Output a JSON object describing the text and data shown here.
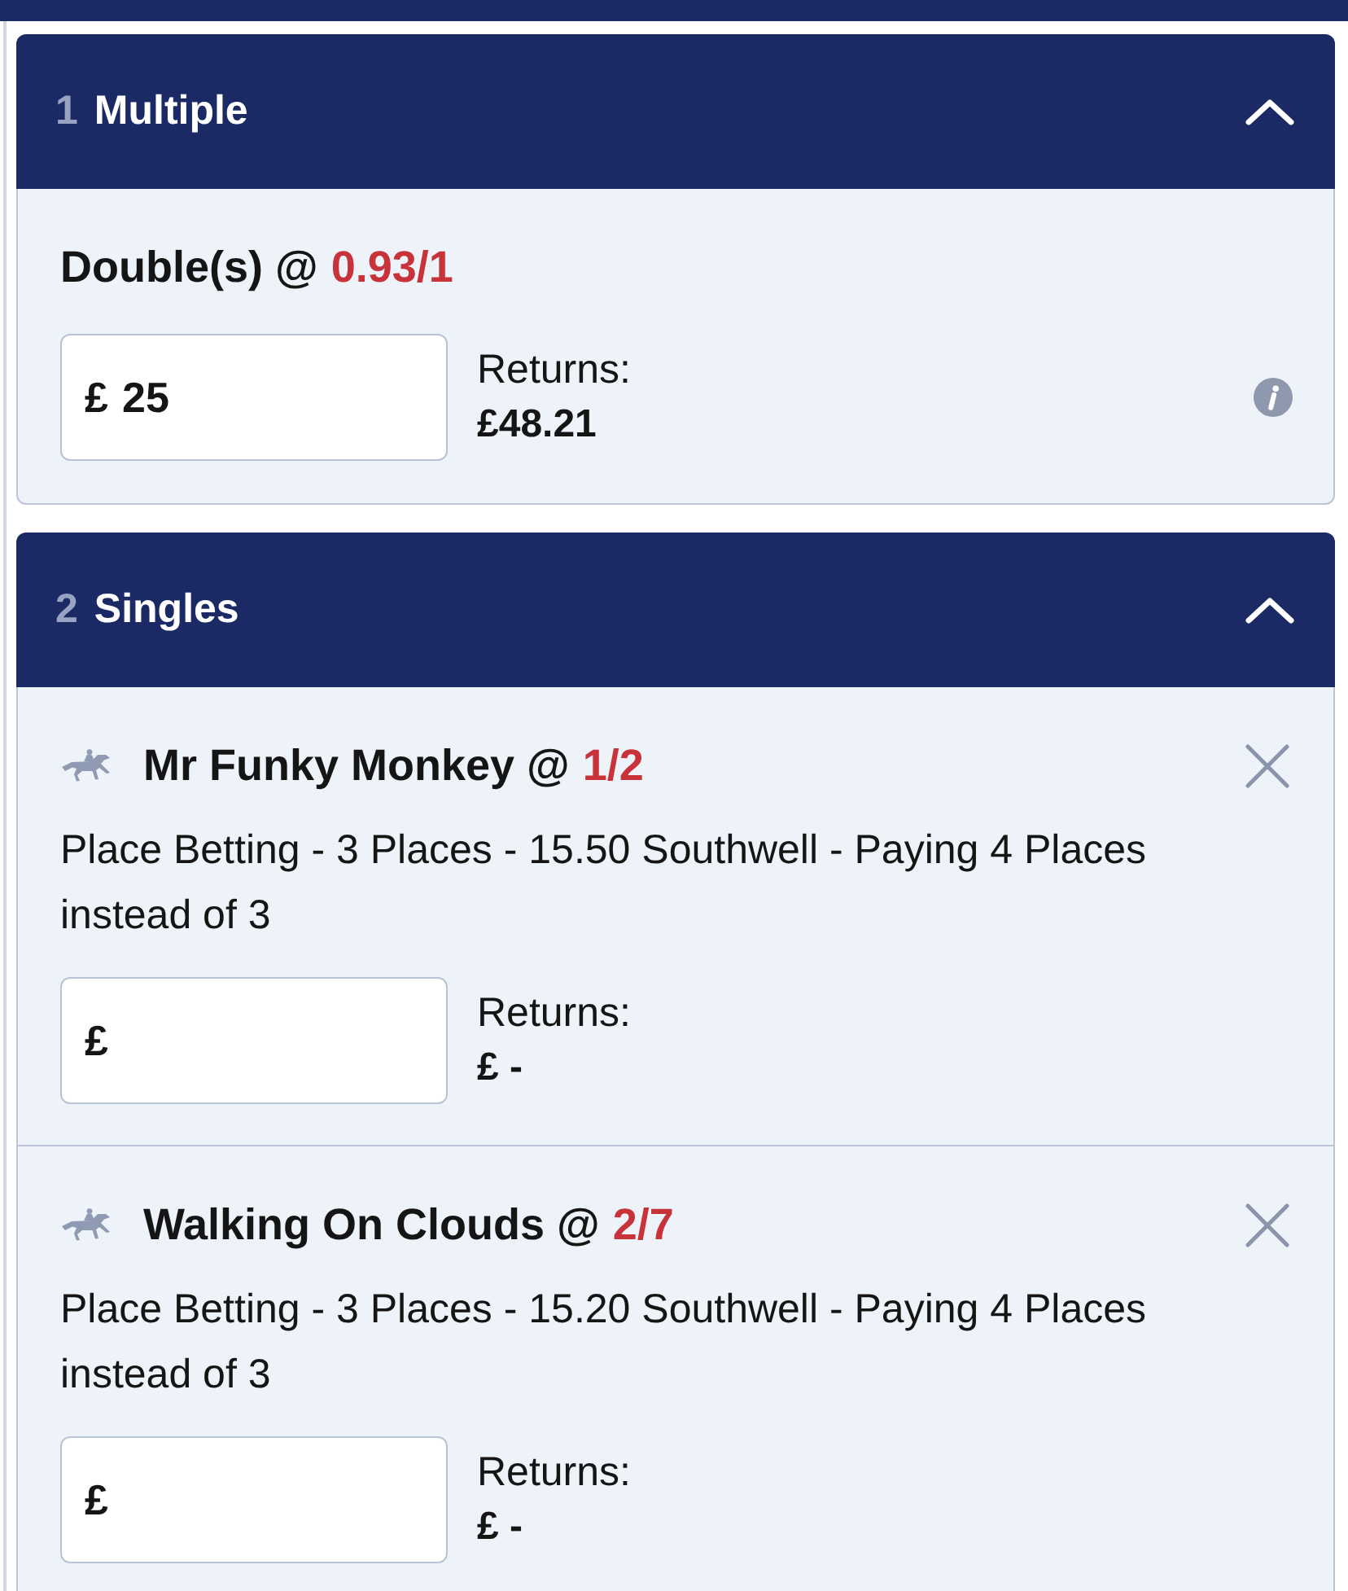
{
  "sections": [
    {
      "kind": "multiple",
      "count": "1",
      "title": "Multiple",
      "expanded": true,
      "bets": [
        {
          "title": "Double(s) @",
          "odds": "0.93/1",
          "currency": "£",
          "stake": "25",
          "returns_label": "Returns:",
          "returns": "£48.21"
        }
      ]
    },
    {
      "kind": "singles",
      "count": "2",
      "title": "Singles",
      "expanded": true,
      "bets": [
        {
          "title": "Mr Funky Monkey @",
          "odds": "1/2",
          "description": "Place Betting - 3 Places - 15.50 Southwell - Paying 4 Places instead of 3",
          "currency": "£",
          "returns_label": "Returns:",
          "returns": "£ -"
        },
        {
          "title": "Walking On Clouds @",
          "odds": "2/7",
          "description": "Place Betting - 3 Places - 15.20 Southwell - Paying 4 Places instead of 3",
          "currency": "£",
          "returns_label": "Returns:",
          "returns": "£ -"
        }
      ]
    }
  ]
}
